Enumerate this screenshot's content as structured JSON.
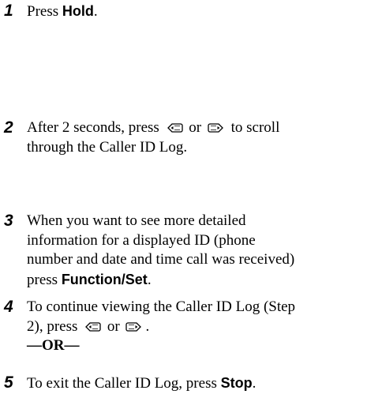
{
  "steps": [
    {
      "number": "1",
      "text_before": "Press ",
      "bold": "Hold",
      "text_after": "."
    },
    {
      "number": "2",
      "line1_a": "After 2 seconds, press",
      "or_word": "or",
      "line1_b": "to scroll",
      "line2": "through the Caller ID Log."
    },
    {
      "number": "3",
      "line1": "When you want to see more detailed",
      "line2": "information for a displayed ID (phone",
      "line3": "number and date and time call was received)",
      "line4_before": "press ",
      "bold": "Function/Set",
      "line4_after": "."
    },
    {
      "number": "4",
      "line1": "To continue viewing the Caller ID Log (Step",
      "line2_a": "2), press",
      "or_word": "or",
      "line2_b": ".",
      "or_line": "—OR—"
    },
    {
      "number": "5",
      "text_before": "To exit the Caller ID Log, press ",
      "bold": "Stop",
      "text_after": "."
    }
  ],
  "icons": {
    "left": "left-arrow-key-icon",
    "right": "right-arrow-key-icon"
  }
}
